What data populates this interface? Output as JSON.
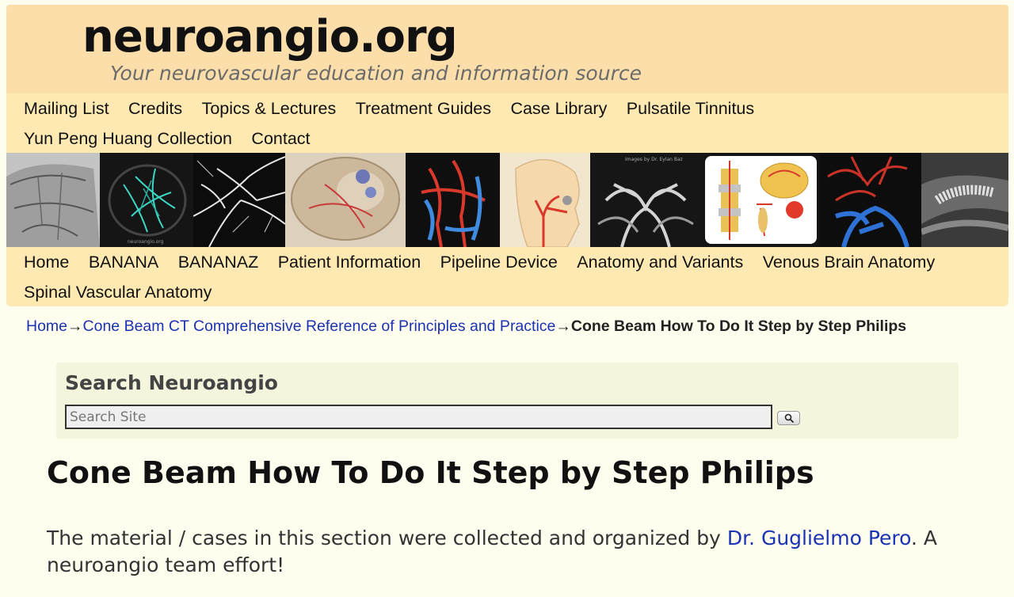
{
  "header": {
    "site_title": "neuroangio.org",
    "tagline": "Your neurovascular education and information source"
  },
  "nav_primary": [
    {
      "label": "Mailing List"
    },
    {
      "label": "Credits"
    },
    {
      "label": "Topics & Lectures"
    },
    {
      "label": "Treatment Guides"
    },
    {
      "label": "Case Library"
    },
    {
      "label": "Pulsatile Tinnitus"
    },
    {
      "label": "Yun Peng Huang Collection"
    },
    {
      "label": "Contact"
    }
  ],
  "nav_secondary": [
    {
      "label": "Home"
    },
    {
      "label": "BANANA"
    },
    {
      "label": "BANANAZ"
    },
    {
      "label": "Patient Information"
    },
    {
      "label": "Pipeline Device"
    },
    {
      "label": "Anatomy and Variants"
    },
    {
      "label": "Venous Brain Anatomy"
    },
    {
      "label": "Spinal Vascular Anatomy"
    }
  ],
  "banner": {
    "label_a": "neuroangio.org",
    "label_b": "Images by Dr. Eylan Baz"
  },
  "breadcrumb": {
    "home": "Home",
    "arrow": "→",
    "parent": "Cone Beam CT Comprehensive Reference of Principles and Practice",
    "current": "Cone Beam How To Do It Step by Step Philips"
  },
  "search": {
    "title": "Search Neuroangio",
    "placeholder": "Search Site"
  },
  "page_title": "Cone Beam How To Do It Step by Step Philips",
  "intro": {
    "before": "The material / cases in this section were collected and organized by ",
    "link": "Dr. Guglielmo Pero",
    "after": ". A neuroangio team effort!"
  },
  "colors": {
    "header_bg": "#fbdeaa",
    "nav_bg": "#fde9b1",
    "page_bg": "#fffdee",
    "search_bg": "#f4f5dc",
    "link": "#1a33b3"
  }
}
